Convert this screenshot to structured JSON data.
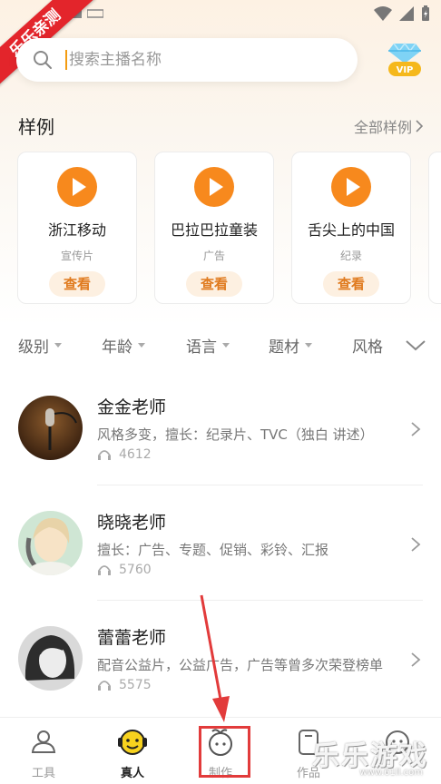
{
  "watermark_ribbon": "乐乐亲测",
  "search": {
    "placeholder": "搜索主播名称"
  },
  "vip": {
    "label": "VIP"
  },
  "samples": {
    "title": "样例",
    "more_label": "全部样例",
    "cards": [
      {
        "name": "浙江移动",
        "type": "宣传片",
        "action": "查看"
      },
      {
        "name": "巴拉巴拉童装",
        "type": "广告",
        "action": "查看"
      },
      {
        "name": "舌尖上的中国",
        "type": "纪录",
        "action": "查看"
      }
    ]
  },
  "filters": [
    "级别",
    "年龄",
    "语言",
    "题材",
    "风格"
  ],
  "teachers": [
    {
      "name": "金金老师",
      "desc": "风格多变，擅长：纪录片、TVC（独白 讲述）",
      "plays": "4612"
    },
    {
      "name": "晓晓老师",
      "desc": "擅长：广告、专题、促销、彩铃、汇报",
      "plays": "5760"
    },
    {
      "name": "蕾蕾老师",
      "desc": "配音公益片，公益广告，广告等曾多次荣登榜单",
      "plays": "5575"
    }
  ],
  "bottom_nav": [
    {
      "label": "工具",
      "icon": "tools-person-icon"
    },
    {
      "label": "真人",
      "icon": "smiley-headphone-icon",
      "active": true
    },
    {
      "label": "制作",
      "icon": "sprout-face-icon"
    },
    {
      "label": "作品",
      "icon": "works-icon"
    },
    {
      "label": "",
      "icon": "mine-icon"
    }
  ],
  "corner_watermark": {
    "title": "乐乐游戏",
    "sub": "www.61ll.com"
  },
  "colors": {
    "accent": "#f7891d",
    "ribbon": "#e3252b",
    "highlight": "#e23b3b"
  }
}
